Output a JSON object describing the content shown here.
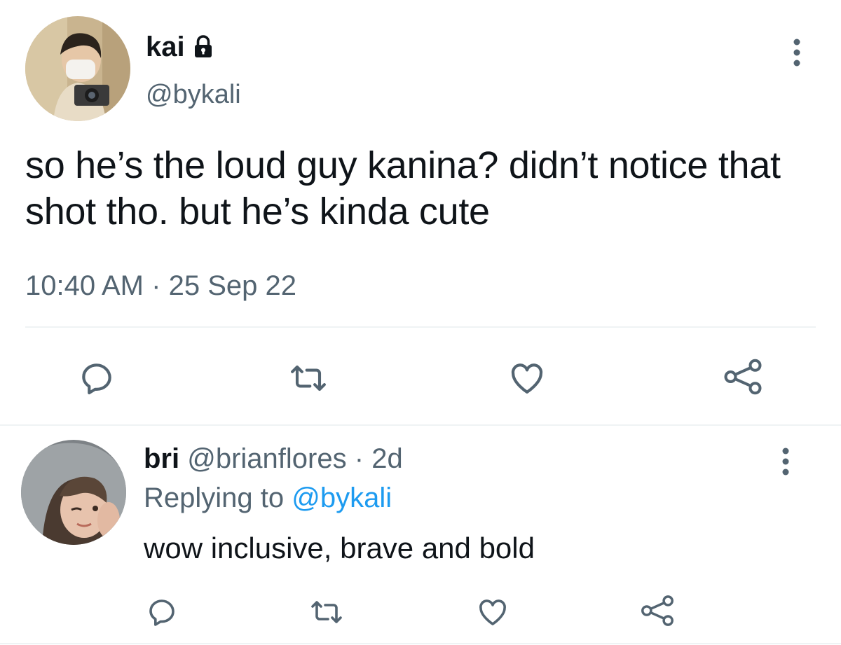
{
  "main_tweet": {
    "display_name": "kai",
    "handle": "@bykali",
    "text": "so he’s the loud guy kanina? didn’t notice that shot tho. but he’s kinda cute",
    "time": "10:40 AM",
    "separator": "·",
    "date": "25 Sep 22",
    "protected_icon": "lock-icon",
    "more_icon": "more-vertical-icon",
    "actions": [
      "reply-icon",
      "retweet-icon",
      "like-icon",
      "share-icon"
    ]
  },
  "reply": {
    "display_name": "bri",
    "handle": "@brianflores",
    "separator": "·",
    "age": "2d",
    "replying_prefix": "Replying to",
    "replying_handle": "@bykali",
    "text": "wow inclusive, brave and bold",
    "more_icon": "more-vertical-icon",
    "actions": [
      "reply-icon",
      "retweet-icon",
      "like-icon",
      "share-icon"
    ]
  },
  "colors": {
    "text": "#0f1419",
    "muted": "#536471",
    "link": "#1d9bf0",
    "divider": "#eff3f4"
  }
}
